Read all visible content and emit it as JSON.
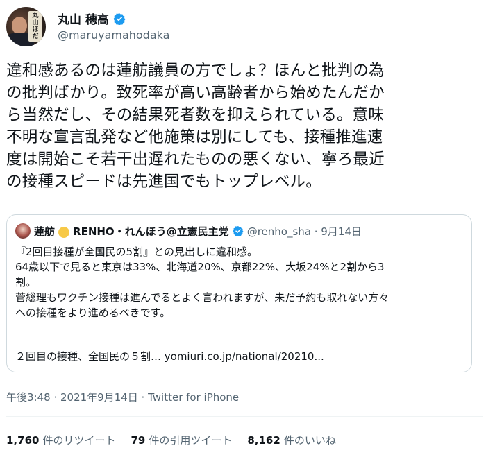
{
  "user": {
    "display_name": "丸山 穂高",
    "handle": "@maruyamahodaka",
    "avatar_sign_text": "丸山ほだか"
  },
  "tweet": {
    "lines": [
      "違和感あるのは蓮舫議員の方でしょ？ほんと批判の為",
      "の批判ばかり。致死率が高い高齢者から始めたんだか",
      "ら当然だし、その結果死者数を抑えられている。意味",
      "不明な宣言乱発など他施策は別にしても、接種推進速",
      "度は開始こそ若干出遅れたものの悪くない、寧ろ最近",
      "の接種スピードは先進国でもトップレベル。"
    ]
  },
  "quote": {
    "name_prefix": "蓮舫",
    "name_suffix": "RENHO・れんほう@立憲民主党",
    "handle_date": "@renho_sha · 9月14日",
    "body_lines": [
      "『2回目接種が全国民の5割』との見出しに違和感。",
      "64歳以下で見ると東京は33%、北海道20%、京都22%、大坂24%と2割から3",
      "割。",
      "菅総理もワクチン接種は進んでるとよく言われますが、未だ予約も取れない方々",
      "への接種をより進めるべきです。"
    ],
    "link_text": "２回目の接種、全国民の５割… yomiuri.co.jp/national/20210..."
  },
  "meta": {
    "timestamp": "午後3:48 · 2021年9月14日 · Twitter for iPhone"
  },
  "stats": {
    "retweets_count": "1,760",
    "retweets_label": "件のリツイート",
    "quotes_count": "79",
    "quotes_label": "件の引用ツイート",
    "likes_count": "8,162",
    "likes_label": "件のいいね"
  },
  "colors": {
    "verified_badge": "#1d9bf0",
    "secondary_text": "#536471",
    "border": "#cfd9de"
  }
}
